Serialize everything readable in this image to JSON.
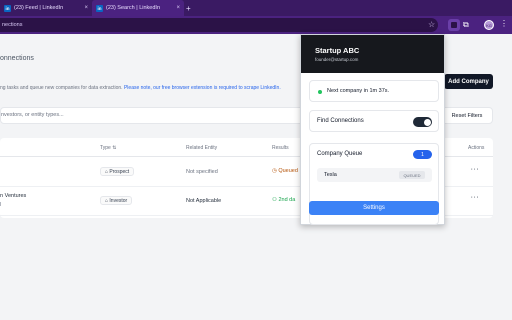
{
  "browser": {
    "tabs": [
      {
        "icon": "in",
        "title": "(23) Feed | LinkedIn",
        "close": "×"
      },
      {
        "icon": "in",
        "title": "(23) Search | LinkedIn",
        "close": "×"
      }
    ],
    "new_tab": "+",
    "address": "nections",
    "profile_initials": "KG"
  },
  "page": {
    "title": "onnections",
    "description": "ng tasks and queue new companies for data extraction.",
    "description_link": "Please note, our free browser extension is required to scrape LinkedIn.",
    "add_company_label": "Add Company",
    "filter_placeholder": "nvestors, or entity types...",
    "reset_filters_label": "Reset Filters",
    "table": {
      "columns": [
        "Type",
        "Related Entity",
        "Results",
        "Actions"
      ],
      "type_sort_icon": "⇅",
      "rows": [
        {
          "name": "",
          "sub": "",
          "type": "Prospect",
          "related": "Not specified",
          "result": "Queued",
          "result_icon": "◷"
        },
        {
          "name": "n Ventures",
          "sub": "l",
          "type": "Investor",
          "related": "Not Applicable",
          "result": "2nd da",
          "result_icon": "⚇"
        }
      ],
      "actions_glyph": "···"
    }
  },
  "popup": {
    "company": "Startup ABC",
    "email": "founder@startup.com",
    "status": "Next company in 1m 37s.",
    "find_connections_label": "Find Connections",
    "find_connections_on": true,
    "queue_title": "Company Queue",
    "queue_count": "1",
    "queue": [
      {
        "name": "Tesla",
        "status": "QUEUED"
      }
    ],
    "settings_label": "Settings"
  },
  "colors": {
    "chrome_purple": "#4b2280",
    "accent_blue": "#3b82f6",
    "status_green": "#22c55e"
  }
}
